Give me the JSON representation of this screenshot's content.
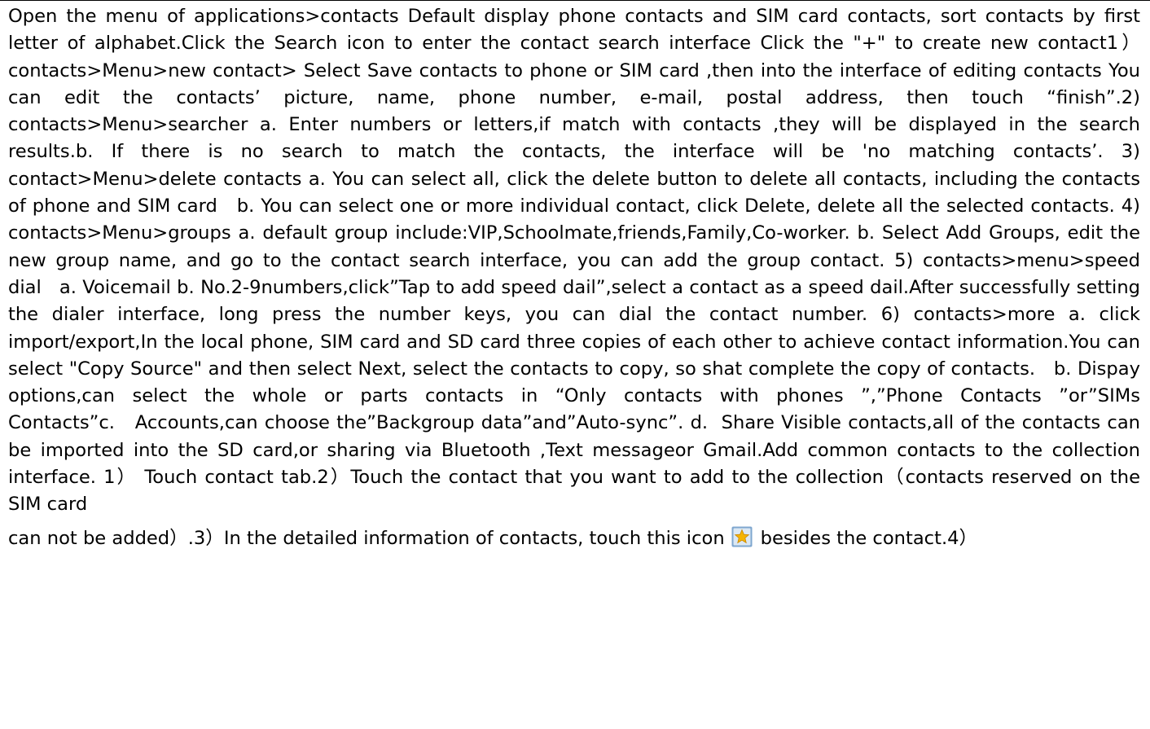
{
  "document": {
    "body_text": "Open the menu of applications>contacts Default display phone contacts and SIM card contacts, sort contacts by first letter of alphabet.Click the Search icon to enter the contact search interface Click the \"+\" to create new contact1）contacts>Menu>new contact> Select Save contacts to phone or SIM card ,then into the interface of editing contacts You can edit the contacts’ picture, name, phone number, e-mail, postal address, then touch “finish”.2) contacts>Menu>searcher a. Enter numbers or letters,if match with contacts ,they will be displayed in the search results.b. If there is no search to match the contacts, the interface will be 'no matching contacts’. 3) contact>Menu>delete contacts a. You can select all, click the delete button to delete all contacts, including the contacts of phone and SIM card   b. You can select one or more individual contact, click Delete, delete all the selected contacts. 4) contacts>Menu>groups a. default group include:VIP,Schoolmate,friends,Family,Co-worker. b. Select Add Groups, edit the new group name, and go to the contact search interface, you can add the group contact. 5) contacts>menu>speed dial   a. Voicemail b. No.2-9numbers,click”Tap to add speed dail”,select a contact as a speed dail.After successfully setting the dialer interface, long press the number keys, you can dial the contact number. 6) contacts>more a. click import/export,In the local phone, SIM card and SD card three copies of each other to achieve contact information.You can select \"Copy Source\" and then select Next, select the contacts to copy, so shat complete the copy of contacts.   b. Dispay options,can select the whole or parts contacts in “Only contacts with phones ”,”Phone Contacts ”or”SIMs Contacts”c.   Accounts,can choose the”Backgroup data”and”Auto-sync”. d.  Share Visible contacts,all of the contacts can be imported into the SD card,or sharing via Bluetooth ,Text messageor Gmail.Add common contacts to the collection interface. 1） Touch contact tab.2）Touch the contact that you want to add to the collection（contacts reserved on the SIM card",
    "last_line_before_icon": "can not be added）.3）In the detailed information of contacts, touch this icon",
    "last_line_after_icon": "besides the contact.4）",
    "inline_icon": {
      "name": "favorite-star-icon",
      "colors": {
        "frame": "#7fa7cf",
        "frame_inner": "#dbe8f4",
        "star": "#f5b400",
        "star_outline": "#c98800"
      }
    }
  }
}
